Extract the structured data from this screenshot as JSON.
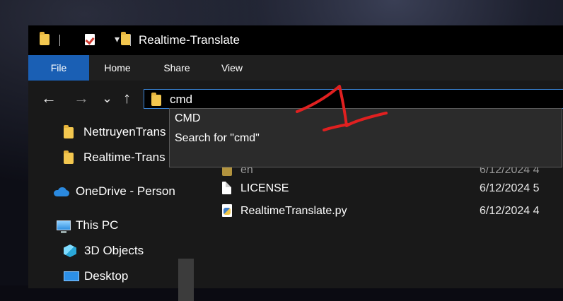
{
  "window": {
    "title": "Realtime-Translate"
  },
  "ribbon": {
    "tabs": [
      "File",
      "Home",
      "Share",
      "View"
    ]
  },
  "nav": {
    "back_glyph": "←",
    "forward_glyph": "→",
    "recent_glyph": "⌄",
    "up_glyph": "↑",
    "address_value": "cmd"
  },
  "sidebar": {
    "items": [
      {
        "label": "NettruyenTrans",
        "icon": "folder-icon"
      },
      {
        "label": "Realtime-Trans",
        "icon": "folder-icon"
      },
      {
        "label": "OneDrive - Person",
        "icon": "onedrive-icon"
      },
      {
        "label": "This PC",
        "icon": "this-pc-icon"
      },
      {
        "label": "3D Objects",
        "icon": "3d-objects-icon"
      },
      {
        "label": "Desktop",
        "icon": "desktop-icon"
      }
    ]
  },
  "files": [
    {
      "name": "LICENSE",
      "date": "6/12/2024 5",
      "icon": "file-icon"
    },
    {
      "name": "RealtimeTranslate.py",
      "date": "6/12/2024 4",
      "icon": "python-file-icon"
    }
  ],
  "partial_row": {
    "name": "en",
    "date": "6/12/2024 4"
  },
  "suggestions": [
    "CMD",
    "Search for \"cmd\""
  ],
  "colors": {
    "accent": "#1a5fb4",
    "annotation": "#e02020",
    "folder": "#f3c74f"
  }
}
